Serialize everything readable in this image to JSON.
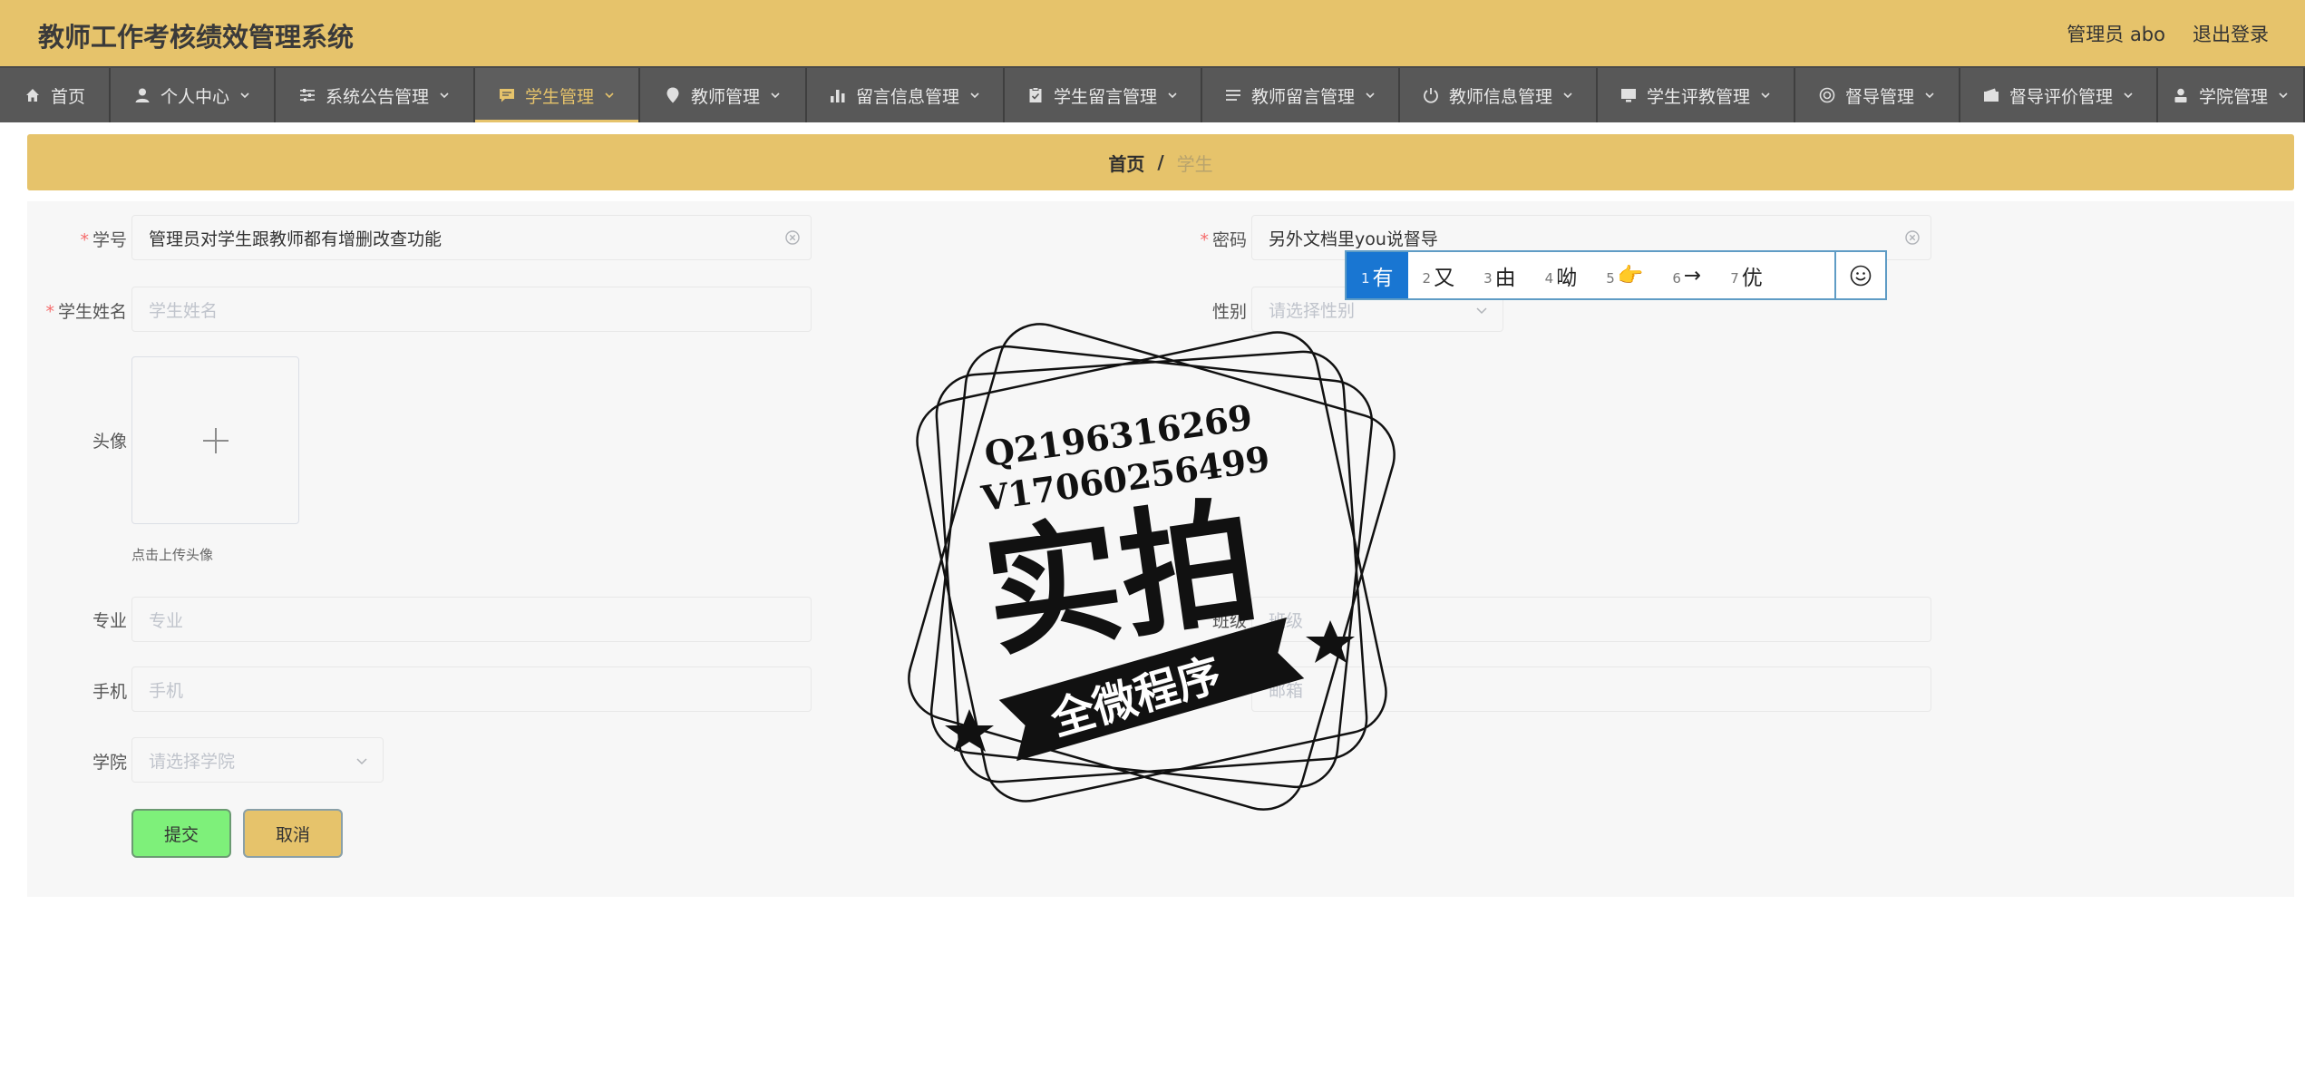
{
  "header": {
    "title": "教师工作考核绩效管理系统",
    "user_label": "管理员 abo",
    "logout_label": "退出登录"
  },
  "nav": {
    "items": [
      {
        "label": "首页",
        "icon": "home-icon"
      },
      {
        "label": "个人中心",
        "icon": "user-icon"
      },
      {
        "label": "系统公告管理",
        "icon": "sliders-icon"
      },
      {
        "label": "学生管理",
        "icon": "chat-icon"
      },
      {
        "label": "教师管理",
        "icon": "location-icon"
      },
      {
        "label": "留言信息管理",
        "icon": "bar-chart-icon"
      },
      {
        "label": "学生留言管理",
        "icon": "clipboard-icon"
      },
      {
        "label": "教师留言管理",
        "icon": "list-icon"
      },
      {
        "label": "教师信息管理",
        "icon": "power-icon"
      },
      {
        "label": "学生评教管理",
        "icon": "monitor-icon"
      },
      {
        "label": "督导管理",
        "icon": "lifebuoy-icon"
      },
      {
        "label": "督导评价管理",
        "icon": "wallet-icon"
      },
      {
        "label": "学院管理",
        "icon": "person-icon"
      }
    ],
    "active_index": 3,
    "active_color": "#e6c36b"
  },
  "breadcrumb": {
    "home": "首页",
    "separator": "/",
    "current": "学生"
  },
  "form": {
    "student_id": {
      "label": "学号",
      "value": "管理员对学生跟教师都有增删改查功能"
    },
    "password": {
      "label": "密码",
      "value": "另外文档里you说督导"
    },
    "student_name": {
      "label": "学生姓名",
      "placeholder": "学生姓名"
    },
    "gender": {
      "label": "性别",
      "placeholder": "请选择性别"
    },
    "avatar": {
      "label": "头像",
      "hint": "点击上传头像"
    },
    "major": {
      "label": "专业",
      "placeholder": "专业"
    },
    "class": {
      "label": "班级",
      "placeholder": "班级"
    },
    "phone": {
      "label": "手机",
      "placeholder": "手机"
    },
    "email": {
      "placeholder": "邮箱"
    },
    "college": {
      "label": "学院",
      "placeholder": "请选择学院"
    },
    "submit_label": "提交",
    "cancel_label": "取消"
  },
  "ime": {
    "candidates": [
      {
        "num": "1",
        "text": "有"
      },
      {
        "num": "2",
        "text": "又"
      },
      {
        "num": "3",
        "text": "由"
      },
      {
        "num": "4",
        "text": "呦"
      },
      {
        "num": "5",
        "text": "👉"
      },
      {
        "num": "6",
        "text": "→"
      },
      {
        "num": "7",
        "text": "优"
      }
    ],
    "active_index": 0
  },
  "watermark": {
    "line1": "Q2196316269",
    "line2": "V17060256499",
    "main": "实拍",
    "banner": "全微程序"
  },
  "colors": {
    "header_bg": "#e6c36b",
    "nav_bg": "#585858",
    "submit_bg": "#7ef07a",
    "cancel_bg": "#e6c36b",
    "required": "#f56c6c",
    "ime_active": "#1976d2"
  }
}
